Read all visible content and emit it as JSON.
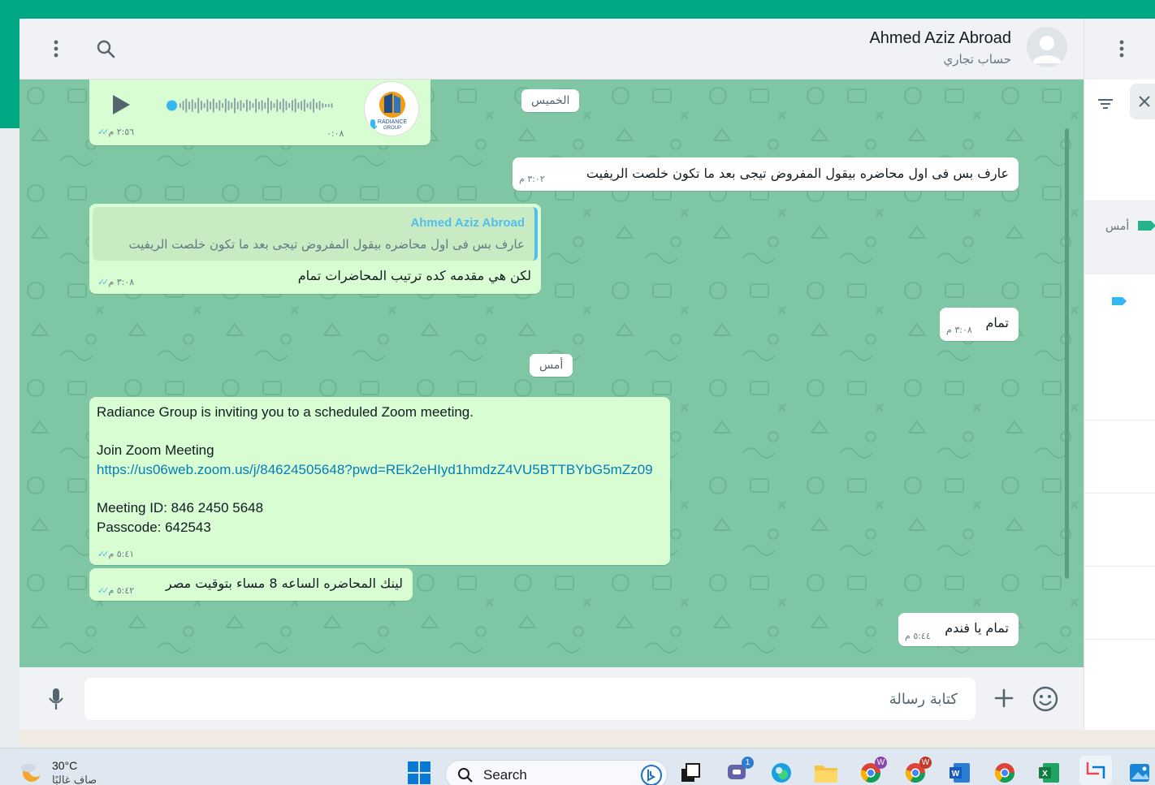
{
  "header": {
    "contact_name": "Ahmed Aziz Abroad",
    "contact_subtitle": "حساب تجاري"
  },
  "messages": {
    "voice": {
      "duration": "٠:٠٨",
      "time": "٢:٥٦ م",
      "logo_text": "RADIANCE GROUP"
    },
    "date_thursday": "الخميس",
    "out1": {
      "text": "عارف بس فى اول محاضره بيقول المفروض تيجى بعد ما تكون خلصت الريفيت",
      "time": "٣:٠٢ م"
    },
    "in_reply": {
      "quoted_author": "Ahmed Aziz Abroad",
      "quoted_text": "عارف بس فى اول محاضره بيقول المفروض تيجى بعد ما تكون خلصت الريفيت",
      "text": "لكن هي مقدمه كده ترتيب المحاضرات تمام",
      "time": "٣:٠٨ م"
    },
    "out2": {
      "text": "تمام",
      "time": "٣:٠٨ م"
    },
    "date_yesterday": "أمس",
    "zoom": {
      "line1": "Radiance Group is inviting you to a scheduled Zoom meeting.",
      "line2": "Join Zoom Meeting",
      "link": "https://us06web.zoom.us/j/84624505648?pwd=REk2eHIyd1hmdzZ4VU5BTTBYbG5mZz09",
      "line3": "Meeting ID: 846 2450 5648",
      "line4": "Passcode: 642543",
      "time": "٥:٤١ م"
    },
    "in3": {
      "text": "لينك المحاضره الساعه 8 مساء بتوقيت مصر",
      "time": "٥:٤٢ م"
    },
    "out3": {
      "text": "تمام يا فندم",
      "time": "٥:٤٤ م"
    }
  },
  "composer": {
    "placeholder": "كتابة رسالة"
  },
  "side_panel": {
    "day_label": "أمس"
  },
  "taskbar": {
    "weather_temp": "30°C",
    "weather_desc": "صافٍ غالبًا",
    "search_label": "Search",
    "teams_badge": "1",
    "chrome_badge_1": "W",
    "chrome_badge_2": "W"
  },
  "colors": {
    "chat_background": "#7fc6a4",
    "incoming_bubble": "#d9fdd3",
    "outgoing_bubble": "#ffffff",
    "accent": "#00a884",
    "read_ticks": "#53bdeb",
    "link": "#027eb5"
  }
}
